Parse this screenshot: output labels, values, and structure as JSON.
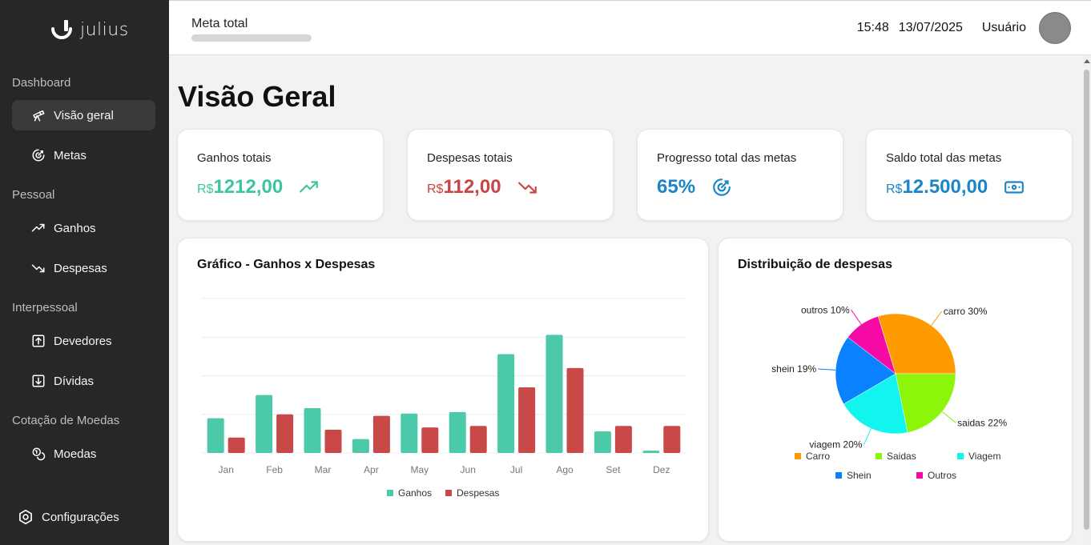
{
  "app": {
    "logo_text": "julius"
  },
  "sidebar": {
    "sections": [
      {
        "label": "Dashboard",
        "items": [
          {
            "label": "Visão geral",
            "icon": "telescope-icon",
            "active": true
          },
          {
            "label": "Metas",
            "icon": "target-icon"
          }
        ]
      },
      {
        "label": "Pessoal",
        "items": [
          {
            "label": "Ganhos",
            "icon": "trending-up-icon"
          },
          {
            "label": "Despesas",
            "icon": "trending-down-icon"
          }
        ]
      },
      {
        "label": "Interpessoal",
        "items": [
          {
            "label": "Devedores",
            "icon": "arrow-up-square-icon"
          },
          {
            "label": "Dívidas",
            "icon": "arrow-down-square-icon"
          }
        ]
      },
      {
        "label": "Cotação de Moedas",
        "items": [
          {
            "label": "Moedas",
            "icon": "coins-icon"
          }
        ]
      }
    ],
    "settings_label": "Configurações"
  },
  "header": {
    "meta_title": "Meta total",
    "time": "15:48",
    "date": "13/07/2025",
    "user": "Usuário"
  },
  "main": {
    "title": "Visão Geral",
    "stats": [
      {
        "label": "Ganhos totais",
        "currency": "R$",
        "value": "1212,00",
        "color": "#3fc4a0",
        "icon": "trending-up-icon"
      },
      {
        "label": "Despesas totais",
        "currency": "R$",
        "value": "112,00",
        "color": "#c94444",
        "icon": "trending-down-icon"
      },
      {
        "label": "Progresso total das metas",
        "currency": "",
        "value": "65%",
        "color": "#1a86c7",
        "icon": "target-icon"
      },
      {
        "label": "Saldo total das metas",
        "currency": "R$",
        "value": "12.500,00",
        "color": "#1a86c7",
        "icon": "banknote-icon"
      }
    ],
    "bar_chart_title": "Gráfico - Ganhos x Despesas",
    "pie_chart_title": "Distribuição de despesas"
  },
  "chart_data": [
    {
      "type": "bar",
      "title": "Gráfico - Ganhos x Despesas",
      "categories": [
        "Jan",
        "Feb",
        "Mar",
        "Apr",
        "May",
        "Jun",
        "Jul",
        "Ago",
        "Set",
        "Dez"
      ],
      "series": [
        {
          "name": "Ganhos",
          "color": "#4cc9a8",
          "values": [
            45,
            75,
            58,
            18,
            51,
            53,
            128,
            153,
            28,
            3
          ]
        },
        {
          "name": "Despesas",
          "color": "#c94848",
          "values": [
            20,
            50,
            30,
            48,
            33,
            35,
            85,
            110,
            35,
            35
          ]
        }
      ],
      "ylim": [
        0,
        200
      ],
      "grid": true,
      "legend": "bottom"
    },
    {
      "type": "pie",
      "title": "Distribuição de despesas",
      "slices": [
        {
          "name": "Carro",
          "label": "carro 30%",
          "value": 30,
          "color": "#ff9a00"
        },
        {
          "name": "Saidas",
          "label": "saidas 22%",
          "value": 22,
          "color": "#8cf50a"
        },
        {
          "name": "Viagem",
          "label": "viagem 20%",
          "value": 20,
          "color": "#12f5ee"
        },
        {
          "name": "Shein",
          "label": "shein 19%",
          "value": 19,
          "color": "#0a82ff"
        },
        {
          "name": "Outros",
          "label": "outros 10%",
          "value": 10,
          "color": "#f50aa5"
        }
      ],
      "legend": "bottom"
    }
  ]
}
